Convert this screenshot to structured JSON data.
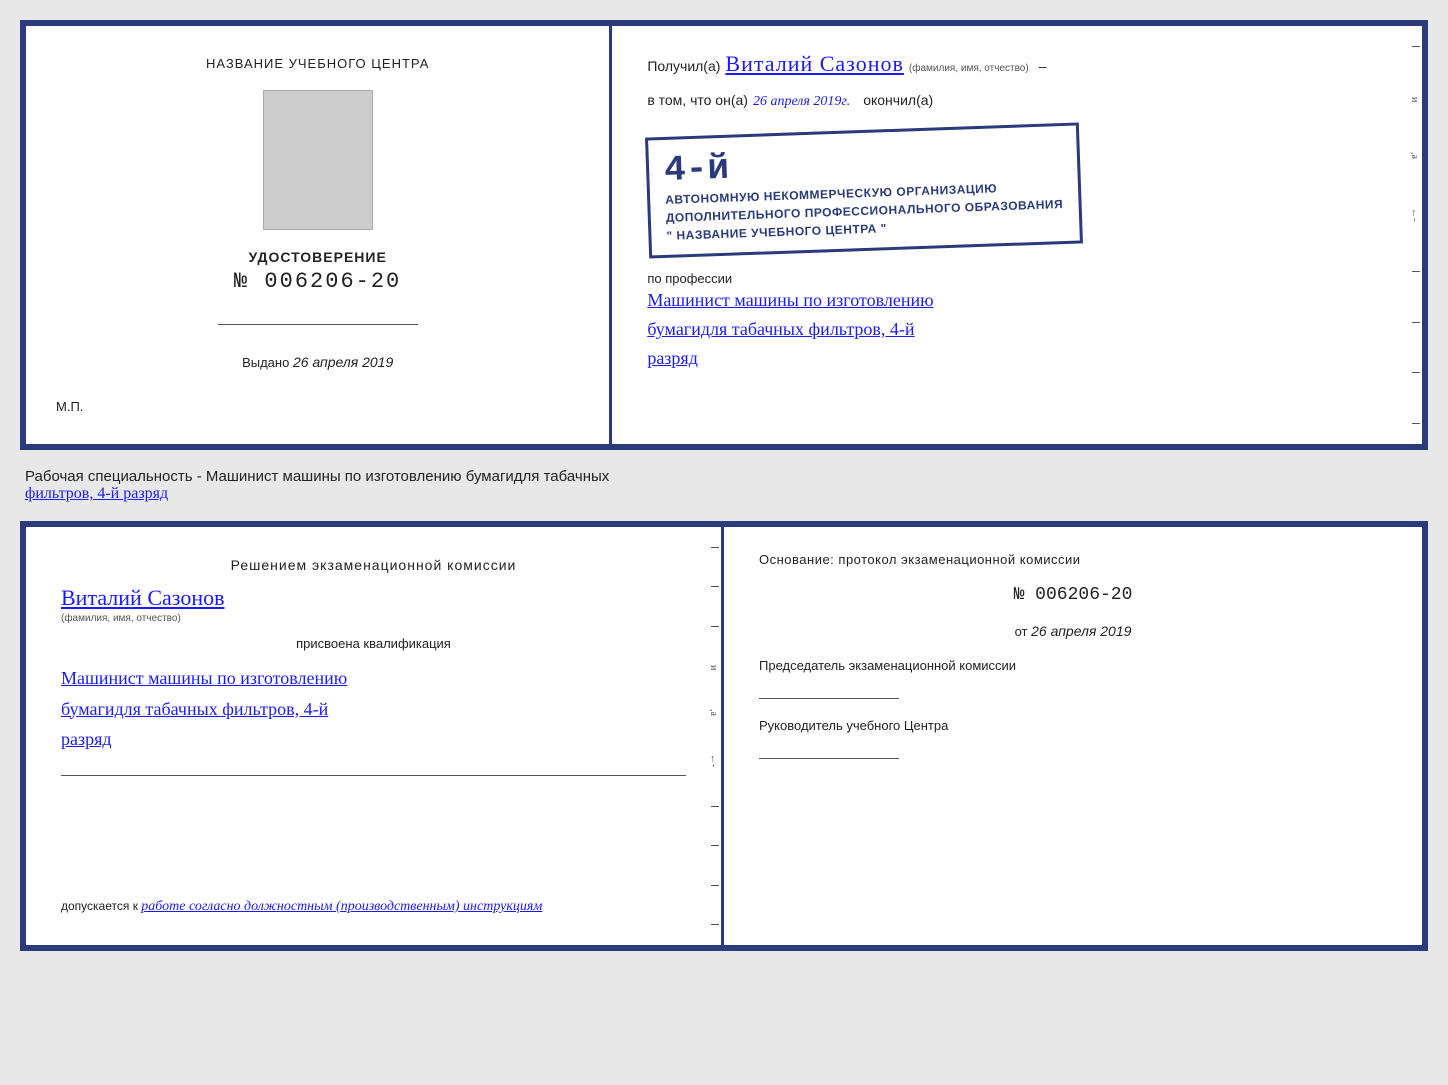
{
  "page": {
    "background": "#e8e8e8"
  },
  "top_cert": {
    "left": {
      "school_name_label": "НАЗВАНИЕ УЧЕБНОГО ЦЕНТРА",
      "udost_title": "УДОСТОВЕРЕНИЕ",
      "udost_number": "№ 006206-20",
      "vydano_label": "Выдано",
      "vydano_date": "26 апреля 2019",
      "mp_label": "М.П."
    },
    "right": {
      "poluchil_label": "Получил(а)",
      "recipient_name": "Виталий Сазонов",
      "fio_sublabel": "(фамилия, имя, отчество)",
      "vtom_label": "в том, что он(а)",
      "date_value": "26 апреля 2019г.",
      "okonchil_label": "окончил(а)",
      "stamp_number": "4-й",
      "stamp_line1": "АВТОНОМНУЮ НЕКОММЕРЧЕСКУЮ ОРГАНИЗАЦИЮ",
      "stamp_line2": "ДОПОЛНИТЕЛЬНОГО ПРОФЕССИОНАЛЬНОГО ОБРАЗОВАНИЯ",
      "stamp_line3": "\" НАЗВАНИЕ УЧЕБНОГО ЦЕНТРА \"",
      "po_professii_label": "по профессии",
      "profession_line1": "Машинист машины по изготовлению",
      "profession_line2": "бумагидля табачных фильтров, 4-й",
      "profession_line3": "разряд"
    }
  },
  "middle": {
    "text": "Рабочая специальность - Машинист машины по изготовлению бумагидля табачных",
    "text2": "фильтров, 4-й разряд"
  },
  "bottom_cert": {
    "left": {
      "resheniem_label": "Решением экзаменационной комиссии",
      "person_name": "Виталий Сазонов",
      "fio_sublabel": "(фамилия, имя, отчество)",
      "prisvoena_label": "присвоена квалификация",
      "qual_line1": "Машинист машины по изготовлению",
      "qual_line2": "бумагидля табачных фильтров, 4-й",
      "qual_line3": "разряд",
      "dopusk_prefix": "допускается к",
      "dopusk_text": "работе согласно должностным (производственным) инструкциям"
    },
    "right": {
      "osnov_label": "Основание: протокол экзаменационной комиссии",
      "protocol_number": "№ 006206-20",
      "ot_label": "от",
      "ot_date": "26 апреля 2019",
      "predsedatel_label": "Председатель экзаменационной комиссии",
      "rukovoditel_label": "Руководитель учебного Центра"
    }
  }
}
